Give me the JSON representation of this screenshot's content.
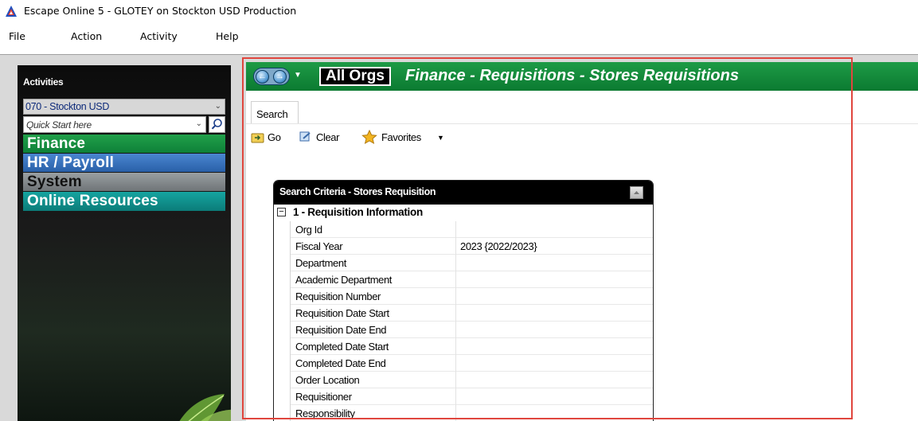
{
  "window": {
    "title": "Escape Online 5 - GLOTEY on Stockton USD Production",
    "icon": "escape-logo-icon"
  },
  "menu": [
    "File",
    "Action",
    "Activity",
    "Help"
  ],
  "sidebar": {
    "heading": "Activities",
    "district_select": "070 - Stockton USD",
    "quick_start_placeholder": "Quick Start here",
    "nav": [
      {
        "label": "Finance",
        "color": "#0e8038"
      },
      {
        "label": "HR / Payroll",
        "color": "#2960a8"
      },
      {
        "label": "System",
        "color": "#6f7477"
      },
      {
        "label": "Online Resources",
        "color": "#0b7c79"
      }
    ]
  },
  "main": {
    "org_badge": "All Orgs",
    "breadcrumb_title": "Finance - Requisitions - Stores Requisitions",
    "tab": "Search",
    "toolbar": {
      "go": "Go",
      "clear": "Clear",
      "favorites": "Favorites"
    },
    "search_criteria": {
      "title": "Search Criteria - Stores Requisition",
      "section": "1 - Requisition Information",
      "fields": [
        {
          "label": "Org Id",
          "value": ""
        },
        {
          "label": "Fiscal Year",
          "value": "2023 {2022/2023}"
        },
        {
          "label": "Department",
          "value": ""
        },
        {
          "label": "Academic Department",
          "value": ""
        },
        {
          "label": "Requisition Number",
          "value": ""
        },
        {
          "label": "Requisition Date Start",
          "value": ""
        },
        {
          "label": "Requisition Date End",
          "value": ""
        },
        {
          "label": "Completed Date Start",
          "value": ""
        },
        {
          "label": "Completed Date End",
          "value": ""
        },
        {
          "label": "Order Location",
          "value": ""
        },
        {
          "label": "Requisitioner",
          "value": ""
        },
        {
          "label": "Responsibility",
          "value": ""
        }
      ]
    }
  },
  "colors": {
    "banner_green": "#0b7a31",
    "highlight_red": "#e0463e"
  }
}
